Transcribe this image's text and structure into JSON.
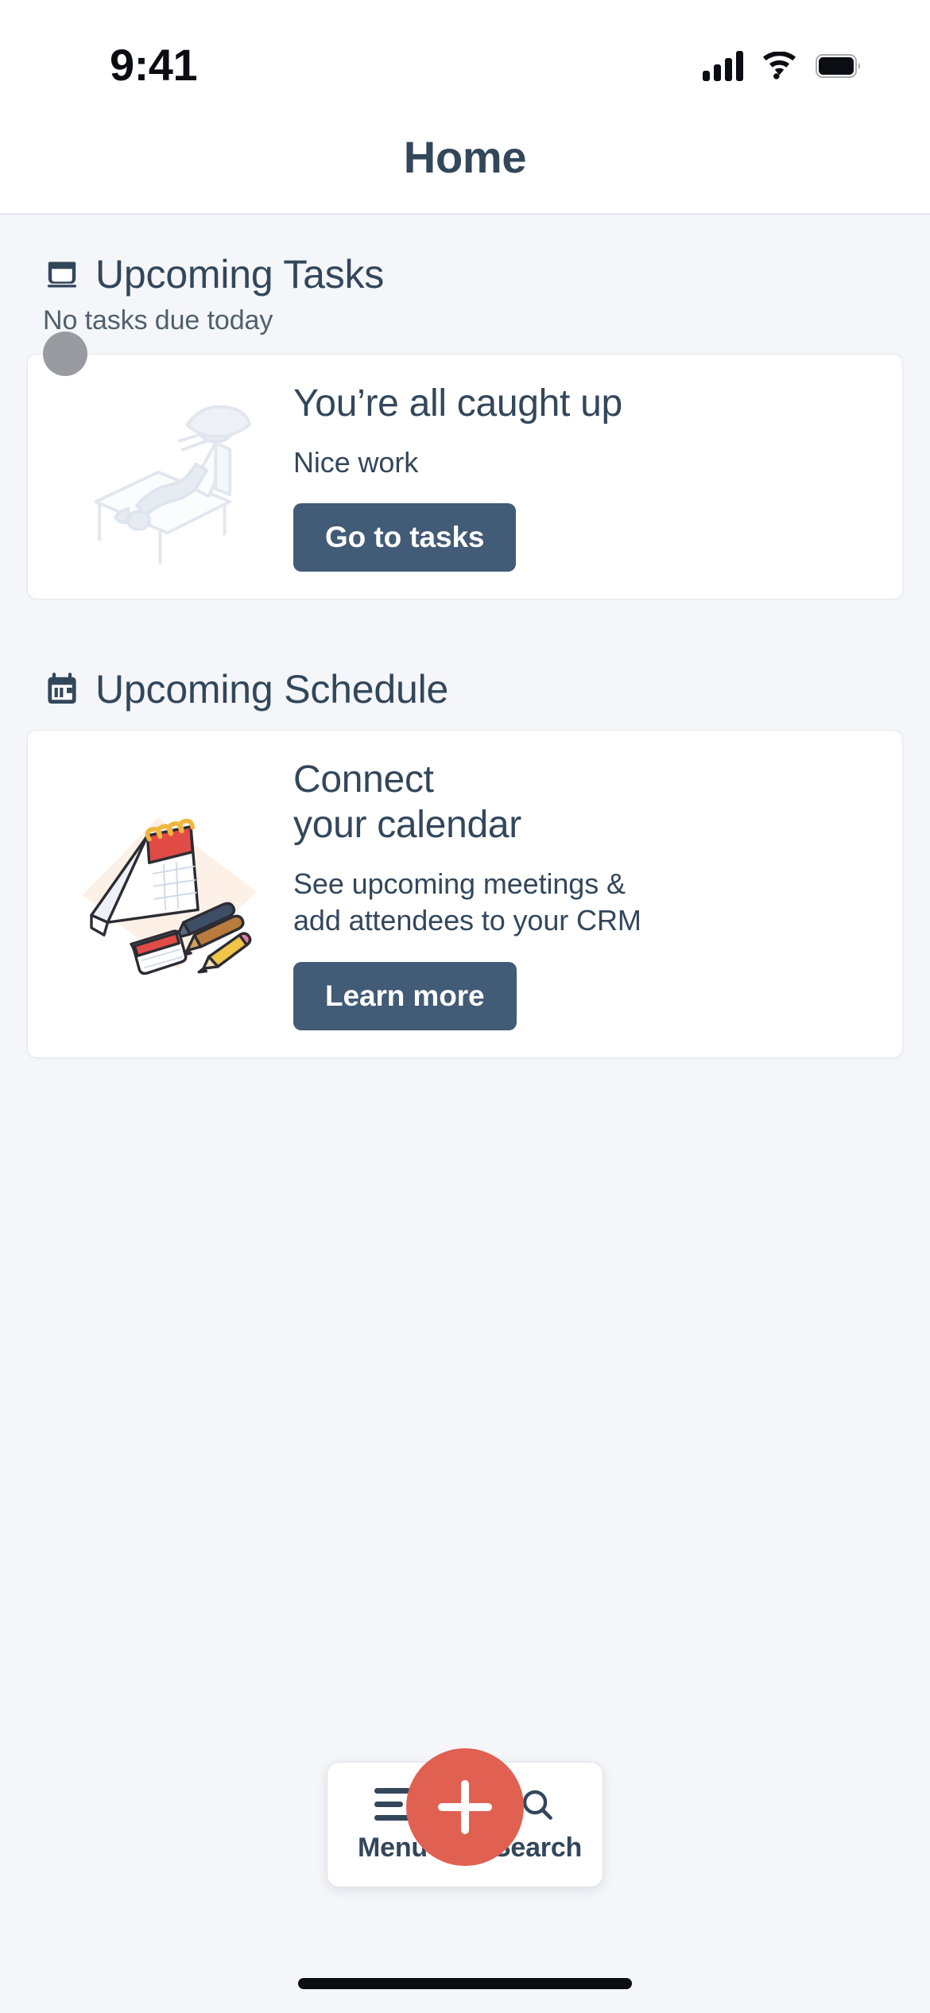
{
  "status_bar": {
    "time": "9:41",
    "signal_icon": "cellular-signal-icon",
    "wifi_icon": "wifi-icon",
    "battery_icon": "battery-full-icon"
  },
  "header": {
    "title": "Home"
  },
  "sections": [
    {
      "icon": "tasks-icon",
      "title": "Upcoming Tasks",
      "subtitle": "No tasks due today",
      "card": {
        "illustration": "person-relaxing-lounge-chair-illustration",
        "title": "You’re all caught up",
        "subtitle": "Nice work",
        "button_label": "Go to tasks",
        "avatar": "user-avatar"
      }
    },
    {
      "icon": "calendar-icon",
      "title": "Upcoming Schedule",
      "card": {
        "illustration": "desk-calendar-pens-pencil-illustration",
        "title": "Connect\nyour calendar",
        "subtitle": "See upcoming meetings &\nadd attendees to your CRM",
        "button_label": "Learn more"
      }
    }
  ],
  "bottom_nav": {
    "menu_label": "Menu",
    "menu_icon": "hamburger-menu-icon",
    "create_icon": "plus-icon",
    "search_label": "Search",
    "search_icon": "search-icon"
  },
  "colors": {
    "page_background": "#f4f6f9",
    "surface": "#ffffff",
    "text_primary": "#33475b",
    "button_primary": "#425b76",
    "accent": "#e06151",
    "avatar": "#9a9ba1"
  }
}
